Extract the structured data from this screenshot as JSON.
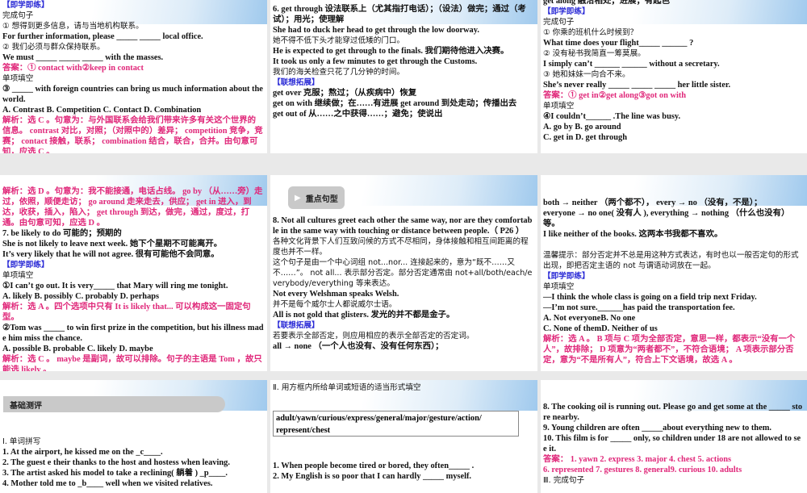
{
  "slides": [
    {
      "id": "s1",
      "lines": [
        {
          "t": "【即学即练】",
          "c": "blue"
        },
        {
          "t": "完成句子",
          "c": "cn"
        },
        {
          "t": "① 想得到更多信息，请与当地机构联系。",
          "c": "cn"
        },
        {
          "t": "For further information, please _____ _____ local office.",
          "c": ""
        },
        {
          "t": "② 我们必须与群众保持联系。",
          "c": "cn"
        },
        {
          "t": "We must _____ _____ _____ with the masses.",
          "c": ""
        },
        {
          "t": "答案：① contact with②keep in contact",
          "c": "pink"
        },
        {
          "t": "单项填空",
          "c": "cn"
        },
        {
          "t": "③ _____ with foreign countries can bring us much information about the world.",
          "c": ""
        },
        {
          "t": "A. Contrast  B. Competition  C. Contact   D. Combination",
          "c": ""
        },
        {
          "t": "解析：选 C 。句意为：与外国联系会给我们带来许多有关这个世界的信息。 contrast 对比，对照；（对照中的）差异； competition 竞争，竞赛； contact 接触，联系； combination 结合，联合，合并。由句意可知，应选 C 。",
          "c": "pink"
        }
      ]
    },
    {
      "id": "s2",
      "lines": [
        {
          "t": "6. get through  设法联系上（尤其指打电话）；（设法）做完；通过（考试）；用光；使理解",
          "c": ""
        },
        {
          "t": "She had to duck her head to get through the low doorway.",
          "c": ""
        },
        {
          "t": "她不得不低下头才能穿过低矮的门口。",
          "c": "cn"
        },
        {
          "t": "He is expected to get through to the finals. 我们期待他进入决赛。",
          "c": ""
        },
        {
          "t": "It took us only a few minutes to get through the Customs.",
          "c": ""
        },
        {
          "t": "我们的海关检查只花了几分钟的时间。",
          "c": "cn"
        },
        {
          "t": "【联想拓展】",
          "c": "blue"
        },
        {
          "t": "get over 克服；熬过；（从疾病中）恢复",
          "c": ""
        },
        {
          "t": "get on with 继续做；在……有进展   get around 到处走动；传播出去",
          "c": ""
        },
        {
          "t": "get out of 从……之中获得……；避免；使说出",
          "c": ""
        }
      ]
    },
    {
      "id": "s3",
      "lines": [
        {
          "t": "get along              融洽相处；进展；有起色",
          "c": ""
        },
        {
          "t": "【即学即练】",
          "c": "blue"
        },
        {
          "t": "完成句子",
          "c": "cn"
        },
        {
          "t": "① 你乘的班机什么时候到？",
          "c": "cn"
        },
        {
          "t": "What time does your flight_____ ______ ?",
          "c": ""
        },
        {
          "t": "② 没有秘书我简直一筹莫展。",
          "c": "cn"
        },
        {
          "t": "I simply can’t ______ ______ without a secretary.",
          "c": ""
        },
        {
          "t": "③ 她和妹妹一向合不来。",
          "c": "cn"
        },
        {
          "t": "She’s never really _____ _____ _____ her little sister.",
          "c": ""
        },
        {
          "t": "答案：① get in②get along③got on with",
          "c": "pink"
        },
        {
          "t": "单项填空",
          "c": "cn"
        },
        {
          "t": "④I couldn’t______ .The line was busy.",
          "c": ""
        },
        {
          "t": "A. go by              B. go around",
          "c": ""
        },
        {
          "t": "C. get in              D. get through",
          "c": ""
        }
      ]
    },
    {
      "id": "s4",
      "lines": [
        {
          "t": "解析：选 D 。句意为：我不能接通，电话占线。 go by （从……旁）走过，依照，顺便走访； go around 走来走去，供应； get in 进入，到达，收获，插入，陷入； get through 到达，做完，通过，度过，打通。由句意可知，应选 D 。",
          "c": "pink"
        },
        {
          "t": "7. be likely to do  可能的；预期的",
          "c": ""
        },
        {
          "t": "She is not likely to leave next week. 她下个星期不可能离开。",
          "c": ""
        },
        {
          "t": "It’s very likely that he will not agree.  很有可能他不会同意。",
          "c": ""
        },
        {
          "t": "【即学即练】",
          "c": "blue"
        },
        {
          "t": "单项填空",
          "c": "cn"
        },
        {
          "t": "①I can’t go out. It is very_____  that Mary will ring me tonight.",
          "c": ""
        },
        {
          "t": "A. likely    B. possibly    C. probably    D. perhaps",
          "c": ""
        },
        {
          "t": "解析：选 A 。四个选项中只有 It is likely that... 可以构成这一固定句型。",
          "c": "pink"
        },
        {
          "t": "②Tom was _____ to win first prize in the competition, but his illness made him miss the chance.",
          "c": ""
        },
        {
          "t": "A. possible    B. probable  C. likely     D.  maybe",
          "c": ""
        },
        {
          "t": "解析：选 C 。 maybe 是副词，故可以排除。句子的主语是 Tom ，故只能选 likely 。",
          "c": "pink"
        }
      ]
    },
    {
      "id": "s5",
      "badge": "重点句型",
      "lines": [
        {
          "t": "8. Not all cultures greet each other the same way, nor are they comfortable in the same way with touching or distance between people.（ P26 ）",
          "c": ""
        },
        {
          "t": "各种文化背景下人们互致问候的方式不尽相同，身体接触和相互间距离的程度也并不一样。",
          "c": "cn"
        },
        {
          "t": "这个句子是由一个中心词组 not...nor... 连接起来的，意为“既不……又不……”。 not all... 表示部分否定。部分否定通常由 not+all/both/each/everybody/everything 等来表达。",
          "c": "cn"
        },
        {
          "t": "Not every Welshman speaks Welsh.",
          "c": ""
        },
        {
          "t": "并不是每个威尔士人都说威尔士语。",
          "c": "cn"
        },
        {
          "t": "All is not gold that glisters. 发光的并不都是金子。",
          "c": ""
        },
        {
          "t": "【联想拓展】",
          "c": "blue"
        },
        {
          "t": "若要表示全部否定，则应用相应的表示全部否定的否定词。",
          "c": "cn"
        },
        {
          "t": "all → none  （一个人也没有、没有任何东西）；",
          "c": ""
        }
      ]
    },
    {
      "id": "s6",
      "lines": [
        {
          "t": "both → neither  （两个都不）， every → no （没有，不是）；",
          "c": ""
        },
        {
          "t": "everyone → no one( 没有人 ), everything → nothing （什么也没有）等。",
          "c": ""
        },
        {
          "t": "I like neither of the books. 这两本书我都不喜欢。",
          "c": ""
        },
        {
          "t": "",
          "c": "gap"
        },
        {
          "t": "温馨提示：部分否定并不总是用这种方式表达，有时也以一般否定句的形式出现，即把否定主语的 not 与谓语动词放在一起。",
          "c": "cn"
        },
        {
          "t": "【即学即练】",
          "c": "blue"
        },
        {
          "t": "单项填空",
          "c": "cn"
        },
        {
          "t": "—I think the whole class is going on a field trip next Friday.",
          "c": ""
        },
        {
          "t": "—I’m not sure.______has paid the transportation fee.",
          "c": ""
        },
        {
          "t": "A. Not everyoneB. No one",
          "c": ""
        },
        {
          "t": "C. None of themD. Neither of us",
          "c": ""
        },
        {
          "t": "解析：选 A 。 B 项与 C 项为全部否定，意思一样，都表示“没有一个人”，故排除； D 项意为“两者都不”，不符合语境； A 项表示部分否定，意为“不是所有人”，符合上下文语境，故选 A 。",
          "c": "pink"
        }
      ]
    },
    {
      "id": "s7",
      "badge": "基础测评",
      "lines": [
        {
          "t": " Ⅰ. 单词拼写",
          "c": "cn"
        },
        {
          "t": "1. At the airport, he kissed me on the _c____.",
          "c": ""
        },
        {
          "t": "2. The guest e their thanks to the host and hostess when leaving.",
          "c": ""
        },
        {
          "t": "3. The artist asked his model to take a reclining( 躺着 ) _p____.",
          "c": ""
        },
        {
          "t": "4. Mother told me to _b____ well when we visited relatives.",
          "c": ""
        }
      ]
    },
    {
      "id": "s8",
      "heading": "Ⅱ. 用方框内所给单词或短语的适当形式填空",
      "wordbox": "adult/yawn/curious/express/general/major/gesture/action/ represent/chest",
      "lines": [
        {
          "t": "1. When people become tired or bored, they often_____ .",
          "c": ""
        },
        {
          "t": "2. My English is so poor that I can hardly _____ myself.",
          "c": ""
        }
      ]
    },
    {
      "id": "s9",
      "lines": [
        {
          "t": "8. The cooking oil is running out. Please go and get some at the _____ store nearby.",
          "c": ""
        },
        {
          "t": "9. Young children are often  _____about everything new to them.",
          "c": ""
        },
        {
          "t": "10. This film is for _____ only, so children under 18 are not allowed to see it.",
          "c": ""
        },
        {
          "t": "答案： 1. yawn  2. express  3. major  4. chest  5. actions",
          "c": "pink"
        },
        {
          "t": "6. represented 7. gestures 8. general9. curious  10. adults",
          "c": "pink"
        },
        {
          "t": "Ⅲ. 完成句子",
          "c": "cn"
        }
      ]
    }
  ]
}
